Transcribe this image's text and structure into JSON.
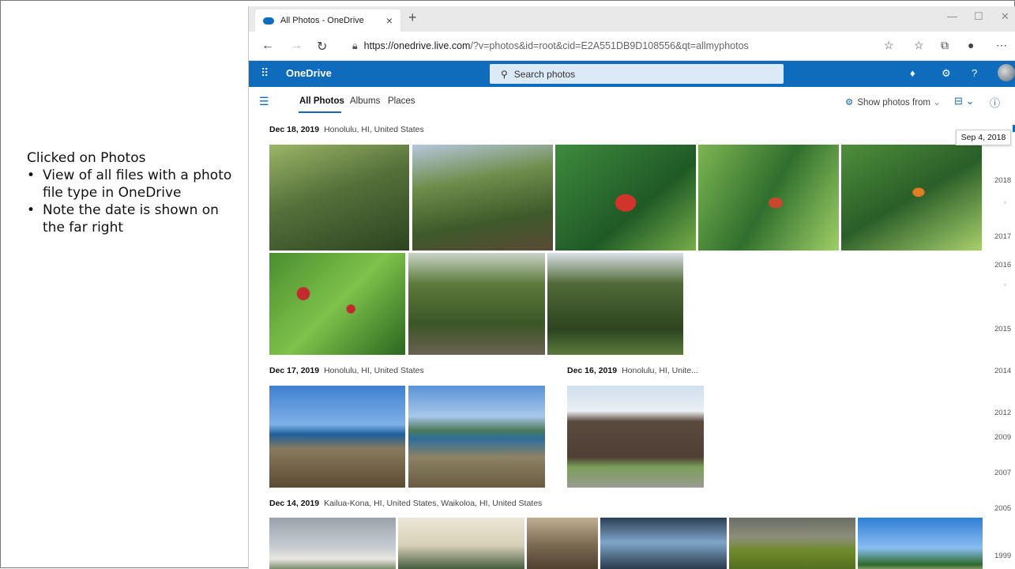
{
  "notes": {
    "heading": "Clicked on Photos",
    "bullets": [
      "View of all files with a photo file type in OneDrive",
      "Note the date is shown on the far right"
    ]
  },
  "browser": {
    "tab_title": "All Photos - OneDrive",
    "url_host": "https://onedrive.live.com",
    "url_path": "/?v=photos&id=root&cid=E2A551DB9D108556&qt=allmyphotos",
    "window_controls": [
      "—",
      "☐",
      "✕"
    ]
  },
  "onedrive": {
    "brand": "OneDrive",
    "search_placeholder": "Search photos",
    "accent": "#0f6cbd"
  },
  "photos_nav": {
    "tabs": [
      "All Photos",
      "Albums",
      "Places"
    ],
    "active_tab": "All Photos",
    "show_from": "Show photos from"
  },
  "groups": [
    {
      "date": "Dec 18, 2019",
      "place": "Honolulu, HI, United States"
    },
    {
      "date": "Dec 17, 2019",
      "place": "Honolulu, HI, United States"
    },
    {
      "date": "Dec 16, 2019",
      "place": "Honolulu, HI, Unite..."
    },
    {
      "date": "Dec 14, 2019",
      "place": "Kailua-Kona, HI, United States, Waikoloa, HI, United States"
    }
  ],
  "timeline": {
    "hover_date": "Sep 4, 2018",
    "years": [
      "2018",
      "2017",
      "2016",
      "2015",
      "2014",
      "2012",
      "2009",
      "2007",
      "2005",
      "1999"
    ]
  }
}
